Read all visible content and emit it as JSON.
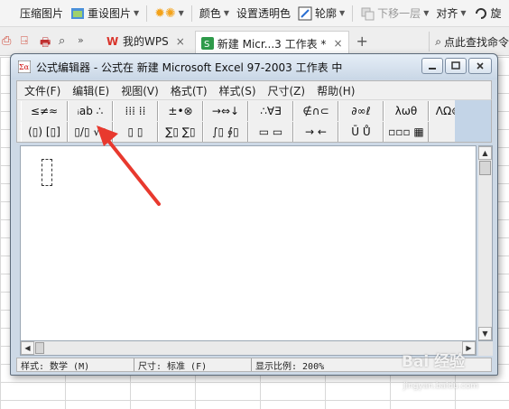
{
  "ribbon": {
    "items": [
      {
        "label": "压缩图片",
        "icon": ""
      },
      {
        "label": "重设图片",
        "icon": "reset-picture-icon"
      },
      {
        "label": "",
        "icon": "brightness-icon"
      },
      {
        "label": "颜色",
        "icon": ""
      },
      {
        "label": "设置透明色",
        "icon": ""
      },
      {
        "label": "轮廓",
        "icon": "outline-icon"
      },
      {
        "label": "下移一层",
        "icon": "move-down-icon"
      },
      {
        "label": "对齐",
        "icon": ""
      },
      {
        "label": "旋",
        "icon": "rotate-icon"
      }
    ]
  },
  "tabs": {
    "items": [
      {
        "label": "我的WPS",
        "icon": "wps-icon"
      },
      {
        "label": "新建 Micr...3 工作表 *",
        "icon": "excel-icon"
      }
    ],
    "search_label": "点此查找命令"
  },
  "window": {
    "title": "公式编辑器 - 公式在 新建 Microsoft Excel 97-2003 工作表 中",
    "menu": [
      "文件(F)",
      "编辑(E)",
      "视图(V)",
      "格式(T)",
      "样式(S)",
      "尺寸(Z)",
      "帮助(H)"
    ],
    "toolbar_row1": [
      "≤≠≈",
      "ᵢab ∴",
      "⁞⁞⁞ ⁞⁞",
      "±•⊗",
      "→⇔↓",
      "∴∀∃",
      "∉∩⊂",
      "∂∞ℓ",
      "λωθ",
      "ΛΩ⊛"
    ],
    "toolbar_row2": [
      "(▯) [▯]",
      "▯/▯ √▯",
      "▯ ▯",
      "∑▯ ∑▯",
      "∫▯ ∮▯",
      "▭ ▭",
      "→ ←",
      "Ū Ů",
      "▫▫▫ ▦"
    ],
    "status": {
      "style": "样式: 数学 (M)",
      "size": "尺寸: 标准 (F)",
      "zoom": "显示比例: 200%"
    }
  },
  "watermark": {
    "text": "Bai 经验",
    "sub": "jingyan.baidu.com"
  },
  "colors": {
    "accent": "#e8392e",
    "titlebar": "#cdd9e6"
  }
}
